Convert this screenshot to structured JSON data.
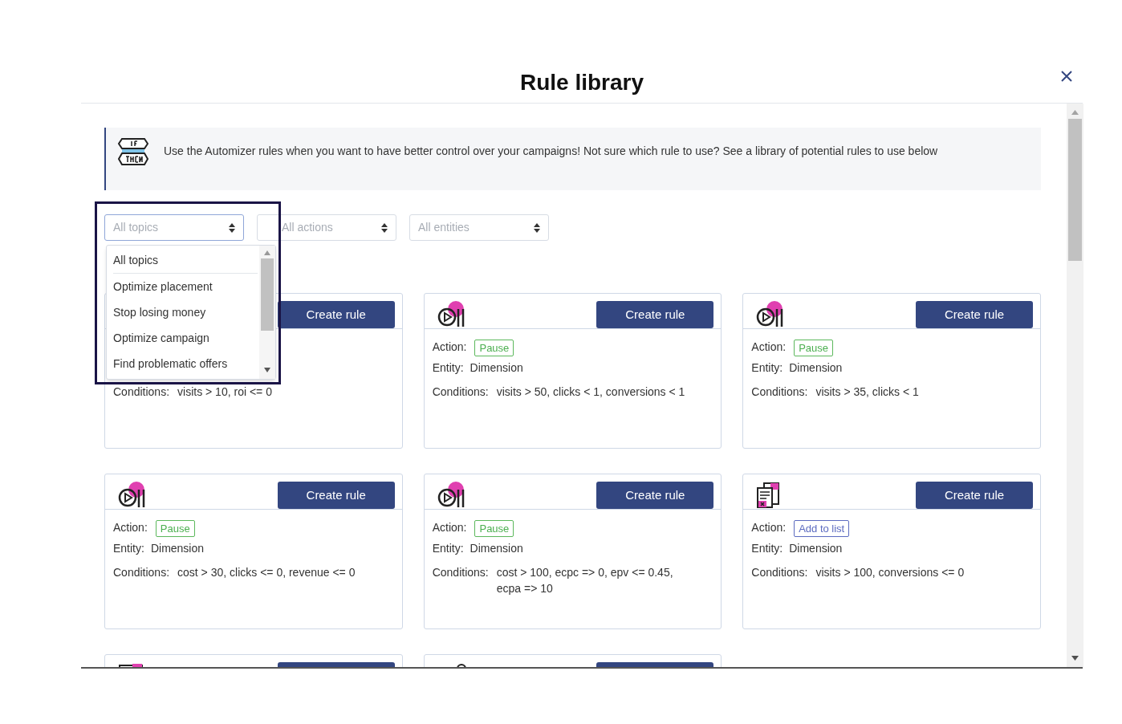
{
  "dialog": {
    "title": "Rule library"
  },
  "info": {
    "text": "Use the Automizer rules when you want to have better control over your campaigns! Not sure which rule to use? See a library of potential rules to use below"
  },
  "filters": [
    {
      "placeholder": "All topics",
      "open": true
    },
    {
      "placeholder": "All actions",
      "open": false
    },
    {
      "placeholder": "All entities",
      "open": false
    }
  ],
  "dropdown": {
    "options": [
      "All topics",
      "Optimize placement",
      "Stop losing money",
      "Optimize campaign",
      "Find problematic offers"
    ]
  },
  "cards": [
    {
      "button": "Create rule",
      "conditions_label": "Conditions:",
      "conditions": "visits > 10, roi <= 0"
    },
    {
      "kind": "pause",
      "button": "Create rule",
      "action_label": "Action:",
      "action": {
        "text": "Pause",
        "kind": "pause"
      },
      "entity_label": "Entity:",
      "entity": "Dimension",
      "conditions_label": "Conditions:",
      "conditions": "visits > 50, clicks < 1, conversions < 1"
    },
    {
      "kind": "pause",
      "button": "Create rule",
      "action_label": "Action:",
      "action": {
        "text": "Pause",
        "kind": "pause"
      },
      "entity_label": "Entity:",
      "entity": "Dimension",
      "conditions_label": "Conditions:",
      "conditions": "visits > 35, clicks < 1"
    },
    {
      "kind": "pause",
      "button": "Create rule",
      "action_label": "Action:",
      "action": {
        "text": "Pause",
        "kind": "pause"
      },
      "entity_label": "Entity:",
      "entity": "Dimension",
      "conditions_label": "Conditions:",
      "conditions": "cost > 30, clicks <= 0, revenue <= 0"
    },
    {
      "kind": "pause",
      "button": "Create rule",
      "action_label": "Action:",
      "action": {
        "text": "Pause",
        "kind": "pause"
      },
      "entity_label": "Entity:",
      "entity": "Dimension",
      "conditions_label": "Conditions:",
      "conditions": "cost > 100, ecpc => 0, epv <= 0.45, ecpa => 10"
    },
    {
      "kind": "list",
      "button": "Create rule",
      "action_label": "Action:",
      "action": {
        "text": "Add to list",
        "kind": "list"
      },
      "entity_label": "Entity:",
      "entity": "Dimension",
      "conditions_label": "Conditions:",
      "conditions": "visits > 100, conversions <= 0"
    },
    {
      "kind": "folder"
    },
    {
      "kind": "tag"
    }
  ]
}
